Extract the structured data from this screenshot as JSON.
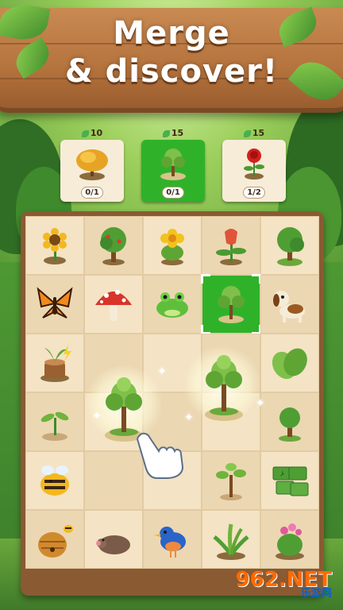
{
  "headline": {
    "line1": "Merge",
    "line2": "& discover!"
  },
  "goals": [
    {
      "cost": "10",
      "progress": "0/1",
      "item": "golden-bush",
      "active": false
    },
    {
      "cost": "15",
      "progress": "0/1",
      "item": "young-tree",
      "active": true
    },
    {
      "cost": "15",
      "progress": "1/2",
      "item": "red-rose",
      "active": false
    }
  ],
  "board": {
    "rows": [
      [
        "sunflower",
        "apple-tree",
        "cactus-flower",
        "tulip-sprout",
        "green-tree"
      ],
      [
        "monarch-butterfly",
        "red-mushroom",
        "green-frog",
        "young-tree",
        "beagle-dog"
      ],
      [
        "stump-sprout",
        "",
        "",
        "",
        "green-leaves"
      ],
      [
        "seedling",
        "",
        "",
        "",
        "small-tree"
      ],
      [
        "bumblebee",
        "",
        "",
        "sapling",
        "forest-cards"
      ],
      [
        "beehive",
        "mole",
        "bluebird",
        "fern-plant",
        "flowering-cactus"
      ]
    ],
    "selected_cell": "young-tree",
    "merge_items": [
      "young-tree",
      "young-tree"
    ]
  },
  "colors": {
    "selected_bg": "#2fb22a",
    "banner_wood": "#b5733d",
    "headline_text": "#ffffff"
  },
  "watermark": {
    "number": "962.NET",
    "subtitle": "乐游网"
  }
}
